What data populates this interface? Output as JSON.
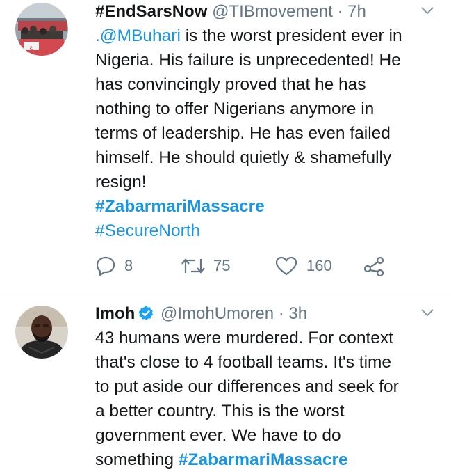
{
  "tweets": [
    {
      "display_name": "#EndSarsNow",
      "handle": "@TIBmovement",
      "separator": "·",
      "time": "7h",
      "mention": ".@MBuhari",
      "text_lines": [
        " is the worst president ever in",
        "Nigeria. His failure is unprecedented! He",
        "has convincingly proved that he has",
        "nothing to offer Nigerians anymore in",
        "terms of leadership. He has even failed",
        "himself. He should quietly & shamefully",
        "resign!"
      ],
      "hashtags": [
        "#ZabarmariMassacre",
        "#SecureNorth"
      ],
      "replies": "8",
      "retweets": "75",
      "likes": "160",
      "avatar_icon": "protest-crowd-avatar"
    },
    {
      "display_name": "Imoh",
      "verified_icon": "verified-badge-icon",
      "handle": "@ImohUmoren",
      "separator": "·",
      "time": "3h",
      "text_lines": [
        "43 humans were murdered. For context",
        "that's close to 4 football teams. It's time",
        "to put aside our differences and seek for",
        "a better country. This is the worst",
        "government ever. We have to do"
      ],
      "last_line_text": "something ",
      "last_line_hashtag": "#ZabarmariMassacre",
      "avatar_icon": "man-portrait-avatar"
    }
  ],
  "colors": {
    "link": "#1b95e0",
    "muted": "#657786",
    "text": "#14171a",
    "verified": "#1da1f2",
    "divider": "#e1e8ed"
  }
}
